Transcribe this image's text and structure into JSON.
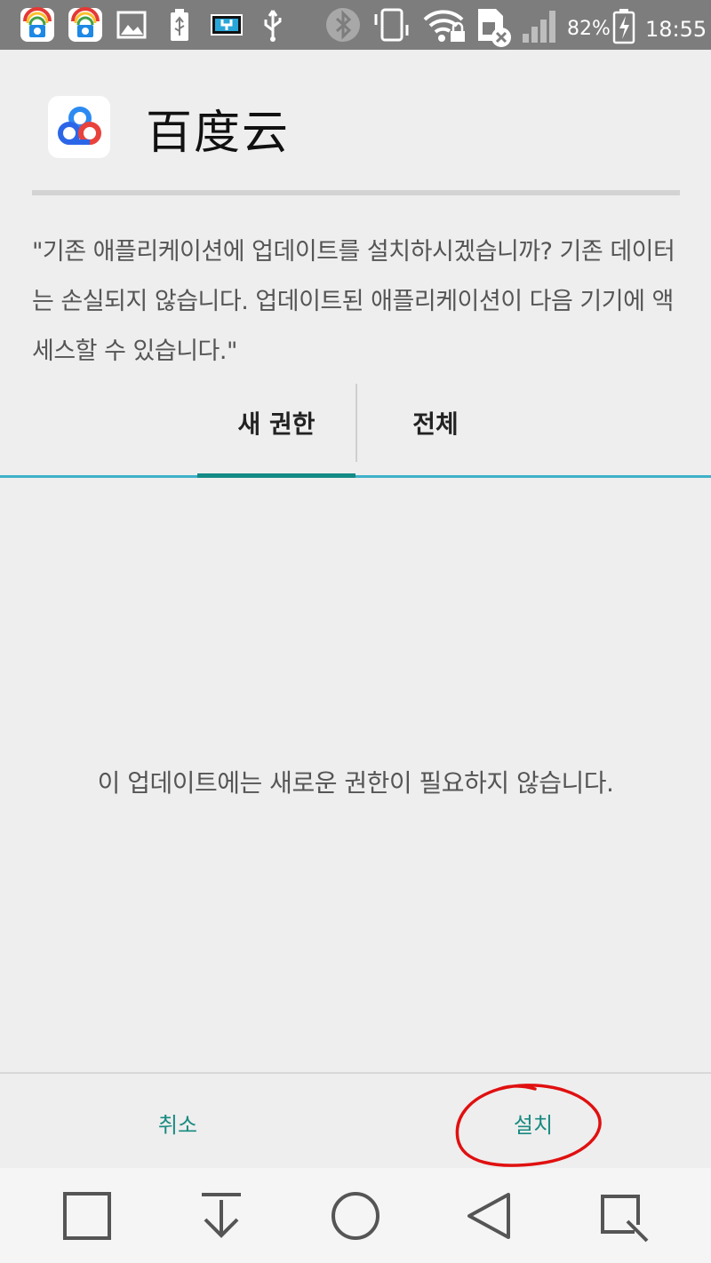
{
  "status_bar": {
    "battery_percent": "82%",
    "time": "18:55",
    "icons": [
      "baidu-app-icon",
      "baidu-app-icon",
      "image-icon",
      "usb-battery-icon",
      "charging-plug-icon",
      "usb-icon",
      "bluetooth-icon",
      "vibrate-icon",
      "wifi-locked-icon",
      "sim-missing-icon",
      "signal-icon",
      "battery-charging-icon"
    ]
  },
  "app": {
    "name": "百度云",
    "icon": "baidu-cloud-logo-icon"
  },
  "message": "\"기존 애플리케이션에 업데이트를 설치하시겠습니까? 기존 데이터는 손실되지 않습니다. 업데이트된 애플리케이션이 다음 기기에 액세스할 수 있습니다.\"",
  "tabs": [
    {
      "label": "새 권한",
      "selected": true
    },
    {
      "label": "전체",
      "selected": false
    }
  ],
  "content": {
    "empty_message": "이 업데이트에는 새로운 권한이 필요하지 않습니다."
  },
  "actions": {
    "cancel_label": "취소",
    "install_label": "설치"
  },
  "nav_bar": {
    "buttons": [
      "recents-square-icon",
      "notification-pulldown-icon",
      "home-circle-icon",
      "back-triangle-icon",
      "qslide-icon"
    ]
  },
  "colors": {
    "accent": "#188a80",
    "tab_indicator": "#138a85",
    "tab_line": "#3db1c8",
    "annotation": "#e01010"
  }
}
